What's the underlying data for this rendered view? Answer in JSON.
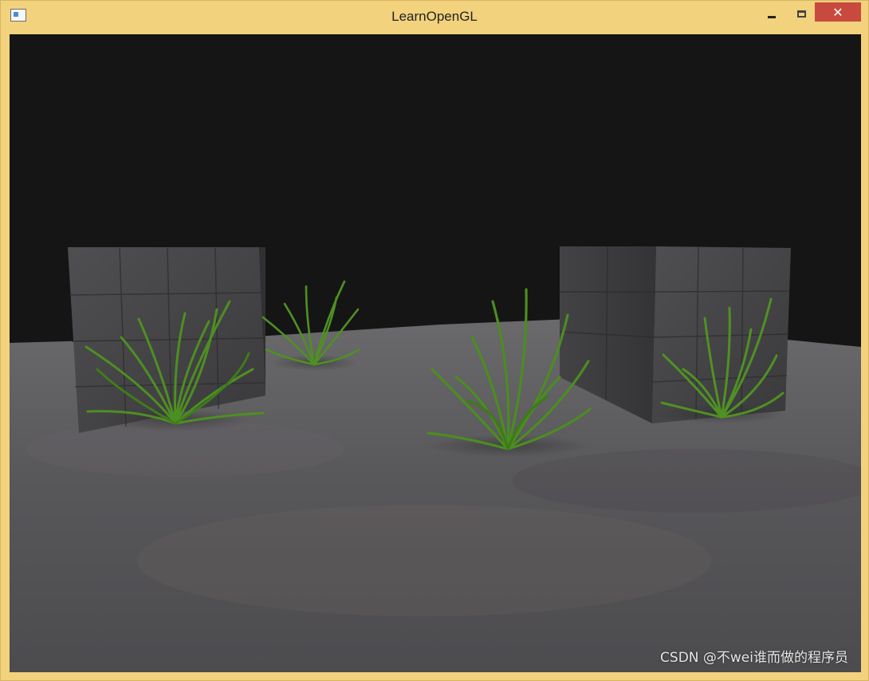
{
  "window": {
    "title": "LearnOpenGL",
    "icon": "app-window-icon",
    "controls": {
      "minimize": "minimize-icon",
      "maximize": "maximize-icon",
      "close_label": "✕"
    }
  },
  "scene": {
    "background_color": "#151515",
    "floor_color": "#5b5a5b",
    "cube_color": "#4a494b",
    "grass_color": "#4a8b23"
  },
  "watermark": "CSDN @不wei谁而做的程序员"
}
